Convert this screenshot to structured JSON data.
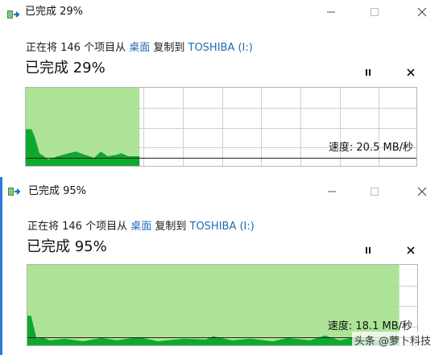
{
  "dialogs": [
    {
      "title": "已完成 29%",
      "status_prefix": "正在将 146 个项目从 ",
      "source": "桌面",
      "middle": " 复制到 ",
      "destination": "TOSHIBA (I:)",
      "percent_label": "已完成 29%",
      "progress": 0.29,
      "speed_label": "速度: 20.5 MB/秒",
      "pause_icon": "pause-icon",
      "cancel_icon": "close-icon"
    },
    {
      "title": "已完成 95%",
      "status_prefix": "正在将 146 个项目从 ",
      "source": "桌面",
      "middle": " 复制到 ",
      "destination": "TOSHIBA (I:)",
      "percent_label": "已完成 95%",
      "progress": 0.95,
      "speed_label": "速度: 18.1 MB/秒",
      "pause_icon": "pause-icon",
      "cancel_icon": "close-icon"
    }
  ],
  "window_controls": [
    "minimize-icon",
    "maximize-icon",
    "close-icon"
  ],
  "watermark": "头条 @萝卜科技",
  "colors": {
    "progress_fill": "#a6e28f",
    "speed_area": "#0fa82e",
    "grid": "#cfcfcf",
    "link": "#1e6bb8",
    "accent_border": "#2b7bd6"
  }
}
